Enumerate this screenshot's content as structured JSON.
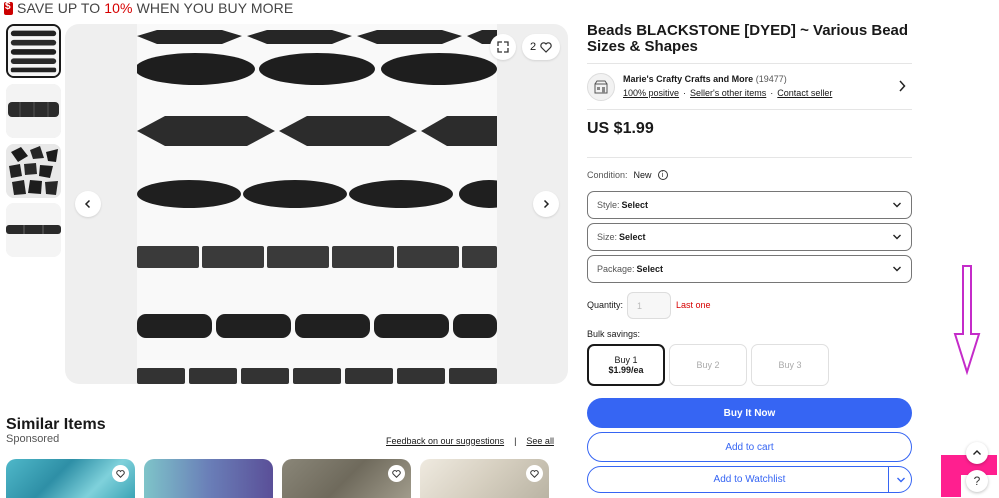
{
  "promo": {
    "prefix": "SAVE UP TO",
    "highlight": "10%",
    "suffix": "WHEN YOU BUY MORE"
  },
  "gallery": {
    "watch_count": "2",
    "thumbnails": [
      "thumbnail-1",
      "thumbnail-2",
      "thumbnail-3",
      "thumbnail-4"
    ]
  },
  "listing": {
    "title": "Beads BLACKSTONE [DYED] ~ Various Bead Sizes & Shapes",
    "price": "US $1.99"
  },
  "seller": {
    "name": "Marie's Crafty Crafts and More",
    "feedback_count": "(19477)",
    "positive": "100% positive",
    "other_items": "Seller's other items",
    "contact": "Contact seller"
  },
  "condition": {
    "label": "Condition:",
    "value": "New"
  },
  "selects": [
    {
      "label": "Style:",
      "value": "Select"
    },
    {
      "label": "Size:",
      "value": "Select"
    },
    {
      "label": "Package:",
      "value": "Select"
    }
  ],
  "quantity": {
    "label": "Quantity:",
    "placeholder": "1",
    "note": "Last one"
  },
  "bulk": {
    "label": "Bulk savings:",
    "options": [
      {
        "line1": "Buy 1",
        "line2": "$1.99/ea"
      },
      {
        "line1": "Buy 2",
        "line2": ""
      },
      {
        "line1": "Buy 3",
        "line2": ""
      }
    ]
  },
  "actions": {
    "buy_now": "Buy It Now",
    "add_to_cart": "Add to cart",
    "watchlist": "Add to Watchlist"
  },
  "similar": {
    "title": "Similar Items",
    "sponsored": "Sponsored",
    "feedback": "Feedback on our suggestions",
    "separator": "|",
    "see_all": "See all"
  },
  "colors": {
    "accent": "#3665f3",
    "alert": "#d60000",
    "text": "#191919"
  },
  "icons": [
    "expand-icon",
    "heart-icon",
    "chevron-left-icon",
    "chevron-right-icon",
    "chevron-down-icon",
    "info-icon",
    "store-icon",
    "chevron-up-icon",
    "help-icon"
  ]
}
